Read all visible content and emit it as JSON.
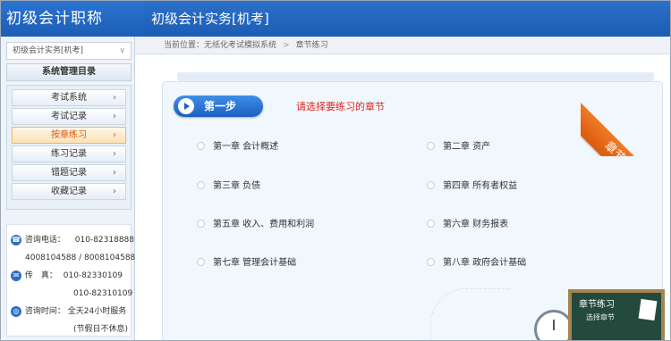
{
  "header": {
    "brand": "初级会计职称",
    "title": "初级会计实务[机考]"
  },
  "sidebar": {
    "course_select": {
      "value": "初级会计实务[机考]",
      "arrow": "∨"
    },
    "menu_title": "系统管理目录",
    "items": [
      {
        "label": "考试系统",
        "active": false
      },
      {
        "label": "考试记录",
        "active": false
      },
      {
        "label": "按章练习",
        "active": true
      },
      {
        "label": "练习记录",
        "active": false
      },
      {
        "label": "错题记录",
        "active": false
      },
      {
        "label": "收藏记录",
        "active": false
      }
    ],
    "contact": {
      "phone_label": "咨询电话：",
      "phone_1": "010-82318888",
      "phone_2": "4008104588 / 8008104588",
      "fax_label": "传　真：",
      "fax_1": "010-82330109",
      "fax_2": "010-82310109",
      "hours_label": "咨询时间：",
      "hours_value": "全天24小时服务",
      "hours_note": "(节假日不休息)"
    }
  },
  "breadcrumb": {
    "prefix": "当前位置：",
    "system": "无纸化考试模拟系统",
    "separator": ">",
    "current": "章节练习"
  },
  "main": {
    "step_label": "第一步",
    "hint": "请选择要练习的章节",
    "ribbon": "章节练习",
    "chapters": [
      "第一章 会计概述",
      "第二章 资产",
      "第三章 负债",
      "第四章 所有者权益",
      "第五章 收入、费用和利润",
      "第六章 财务报表",
      "第七章 管理会计基础",
      "第八章 政府会计基础"
    ],
    "board": {
      "title": "章节练习",
      "subtitle": "选择章节"
    }
  },
  "colors": {
    "header_blue": "#1d5db4",
    "active_orange": "#d9550a",
    "hint_red": "#e0231c",
    "ribbon_orange": "#f27a24"
  }
}
